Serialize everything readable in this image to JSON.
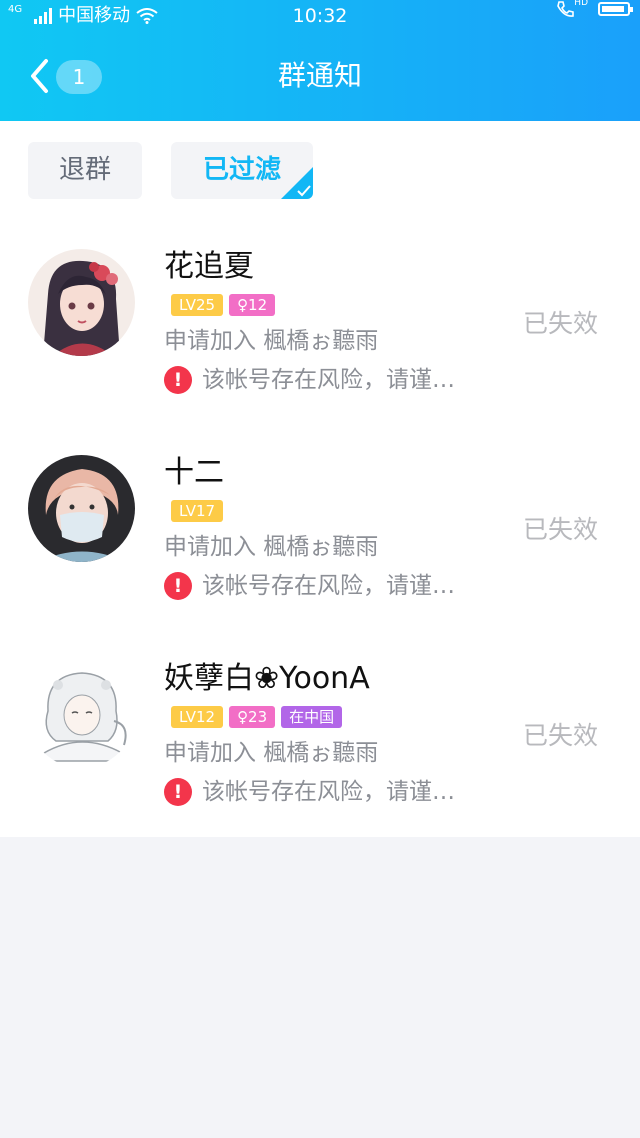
{
  "status_bar": {
    "network": "4G",
    "carrier": "中国移动",
    "time": "10:32",
    "hd": "HD"
  },
  "header": {
    "unread_count": "1",
    "title": "群通知"
  },
  "filters": {
    "quit": "退群",
    "filtered": "已过滤"
  },
  "requests": [
    {
      "name": "花追夏",
      "tags": [
        {
          "type": "level",
          "text": "LV25"
        },
        {
          "type": "gender",
          "text": "♀12"
        }
      ],
      "desc": "申请加入 楓橋ぉ聽雨",
      "warning": "该帐号存在风险，请谨…",
      "status": "已失效"
    },
    {
      "name": "十二",
      "tags": [
        {
          "type": "level",
          "text": "LV17"
        }
      ],
      "desc": "申请加入 楓橋ぉ聽雨",
      "warning": "该帐号存在风险，请谨…",
      "status": "已失效"
    },
    {
      "name": "妖孽白❀YoonA",
      "tags": [
        {
          "type": "level",
          "text": "LV12"
        },
        {
          "type": "gender",
          "text": "♀23"
        },
        {
          "type": "location",
          "text": "在中国"
        }
      ],
      "desc": "申请加入 楓橋ぉ聽雨",
      "warning": "该帐号存在风险，请谨…",
      "status": "已失效"
    }
  ],
  "colors": {
    "header_start": "#10c8f3",
    "header_end": "#1aa0fa",
    "accent": "#12b7f5",
    "warning": "#f3354b",
    "level_tag": "#fdcb47",
    "gender_tag": "#f26ec6",
    "location_tag": "#b266e8"
  }
}
